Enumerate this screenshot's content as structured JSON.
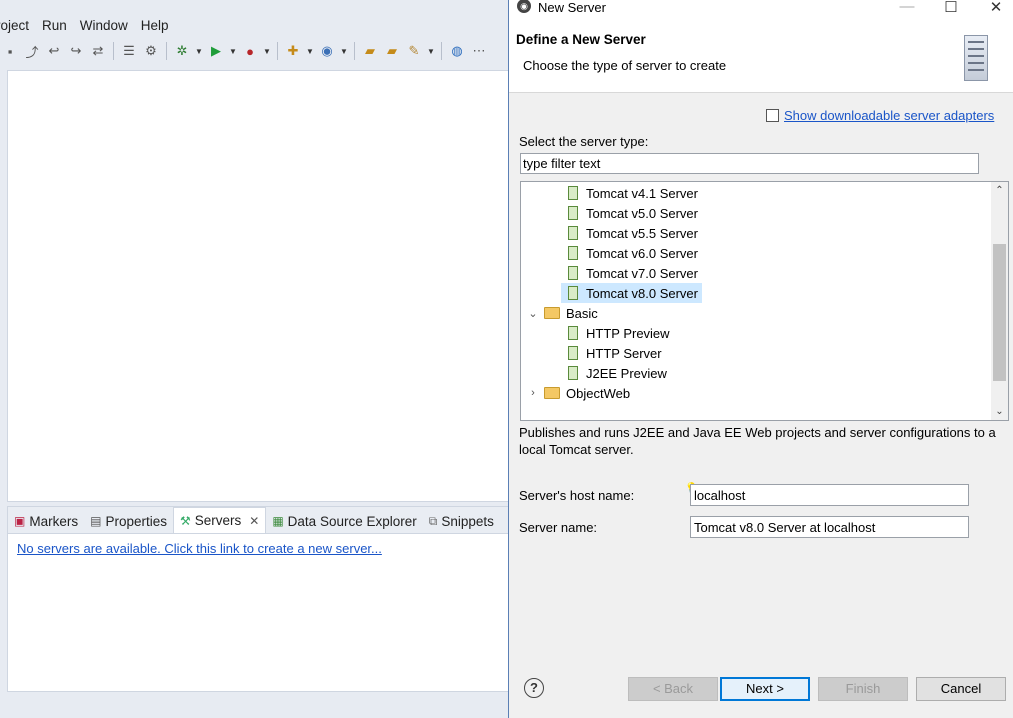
{
  "eclipse": {
    "menu": [
      "roject",
      "Run",
      "Window",
      "Help"
    ],
    "views": {
      "tabs": [
        {
          "label": "Markers",
          "icon": "markers-icon"
        },
        {
          "label": "Properties",
          "icon": "properties-icon"
        },
        {
          "label": "Servers",
          "icon": "servers-icon",
          "active": true
        },
        {
          "label": "Data Source Explorer",
          "icon": "data-source-icon"
        },
        {
          "label": "Snippets",
          "icon": "snippets-icon"
        }
      ],
      "servers_empty_link": "No servers are available. Click this link to create a new server..."
    }
  },
  "dialog": {
    "title": "New Server",
    "banner_title": "Define a New Server",
    "banner_subtitle": "Choose the type of server to create",
    "show_adapters_label": "Show downloadable server adapters",
    "select_label": "Select the server type:",
    "filter_placeholder": "type filter text",
    "tree": [
      {
        "label": "Tomcat v4.1 Server",
        "type": "server",
        "level": 2
      },
      {
        "label": "Tomcat v5.0 Server",
        "type": "server",
        "level": 2
      },
      {
        "label": "Tomcat v5.5 Server",
        "type": "server",
        "level": 2
      },
      {
        "label": "Tomcat v6.0 Server",
        "type": "server",
        "level": 2
      },
      {
        "label": "Tomcat v7.0 Server",
        "type": "server",
        "level": 2
      },
      {
        "label": "Tomcat v8.0 Server",
        "type": "server",
        "level": 2,
        "selected": true
      },
      {
        "label": "Basic",
        "type": "folder",
        "level": 1,
        "expanded": true
      },
      {
        "label": "HTTP Preview",
        "type": "server",
        "level": 2
      },
      {
        "label": "HTTP Server",
        "type": "server",
        "level": 2
      },
      {
        "label": "J2EE Preview",
        "type": "server",
        "level": 2
      },
      {
        "label": "ObjectWeb",
        "type": "folder",
        "level": 1,
        "expanded": false
      }
    ],
    "description": "Publishes and runs J2EE and Java EE Web projects and server configurations to a local Tomcat server.",
    "host_label": "Server's host name:",
    "host_value": "localhost",
    "name_label": "Server name:",
    "name_value": "Tomcat v8.0 Server at localhost",
    "buttons": {
      "back": "< Back",
      "next": "Next >",
      "finish": "Finish",
      "cancel": "Cancel"
    }
  }
}
